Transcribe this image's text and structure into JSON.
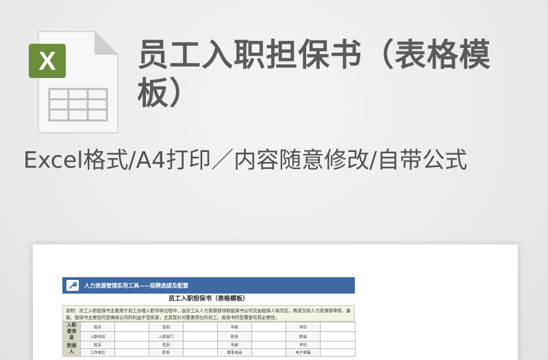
{
  "header": {
    "title": "员工入职担保书（表格模板）",
    "subtitle": "Excel格式/A4打印／内容随意修改/自带公式"
  },
  "icon": {
    "name": "excel-file-icon",
    "badge_letter": "X",
    "badge_color": "#6b8e3a"
  },
  "preview": {
    "banner": "人力资源管理实用工具——招聘选拔及配置",
    "sheet_title": "员工入职担保书（表格模板）",
    "notes": "说明：员工入职担保书主要用于员工办理入职手续过程中，由员工从人力资源部领取担保书公司交由担保人填写后，再递交给人力资源部审核、备案。担保书主要目的是确保公司的利益不受损害，尤其是针对重要岗位的员工，担保书的签署更有其必要性。",
    "sections": [
      {
        "label": "入职者信息",
        "rows": [
          [
            "姓名",
            "",
            "性别",
            "",
            "年龄",
            "",
            "学历",
            ""
          ],
          [
            "入职时间",
            "",
            "入职部门",
            "",
            "职务",
            "",
            "职级",
            ""
          ]
        ]
      },
      {
        "label": "担保人",
        "rows": [
          [
            "姓名",
            "",
            "性别",
            "",
            "年龄",
            "",
            "学历",
            ""
          ],
          [
            "工作单位",
            "",
            "职务",
            "",
            "联系电话",
            "",
            "电子邮箱",
            ""
          ]
        ]
      }
    ]
  }
}
